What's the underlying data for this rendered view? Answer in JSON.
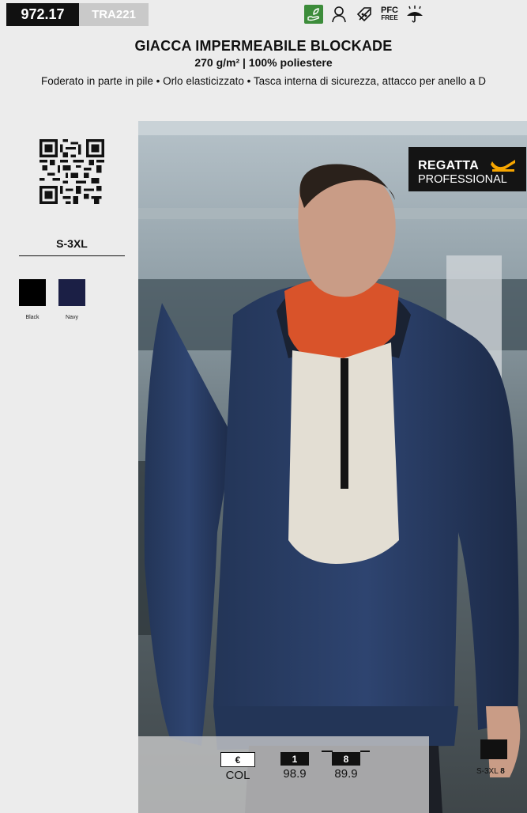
{
  "header": {
    "code": "972.17",
    "ref": "TRA221",
    "pfc_line1": "PFC",
    "pfc_line2": "FREE"
  },
  "product": {
    "title": "GIACCA IMPERMEABILE BLOCKADE",
    "subtitle": "270 g/m² | 100% poliestere",
    "features": "Foderato in parte in pile • Orlo elasticizzato • Tasca interna di sicurezza, attacco per anello a D"
  },
  "sidebar": {
    "sizes": "S-3XL",
    "colors": [
      {
        "name": "Black",
        "hex": "#000000"
      },
      {
        "name": "Navy",
        "hex": "#1b1f45"
      }
    ]
  },
  "brand": {
    "line1": "REGATTA",
    "line2": "PROFESSIONAL",
    "accent": "#f7a600"
  },
  "pricing": {
    "columns": [
      {
        "head": "€",
        "value": "COL"
      },
      {
        "head": "1",
        "value": "98.9"
      },
      {
        "head": "8",
        "value": "89.9"
      }
    ]
  },
  "pack": {
    "size_range": "S-3XL",
    "qty": "8"
  }
}
